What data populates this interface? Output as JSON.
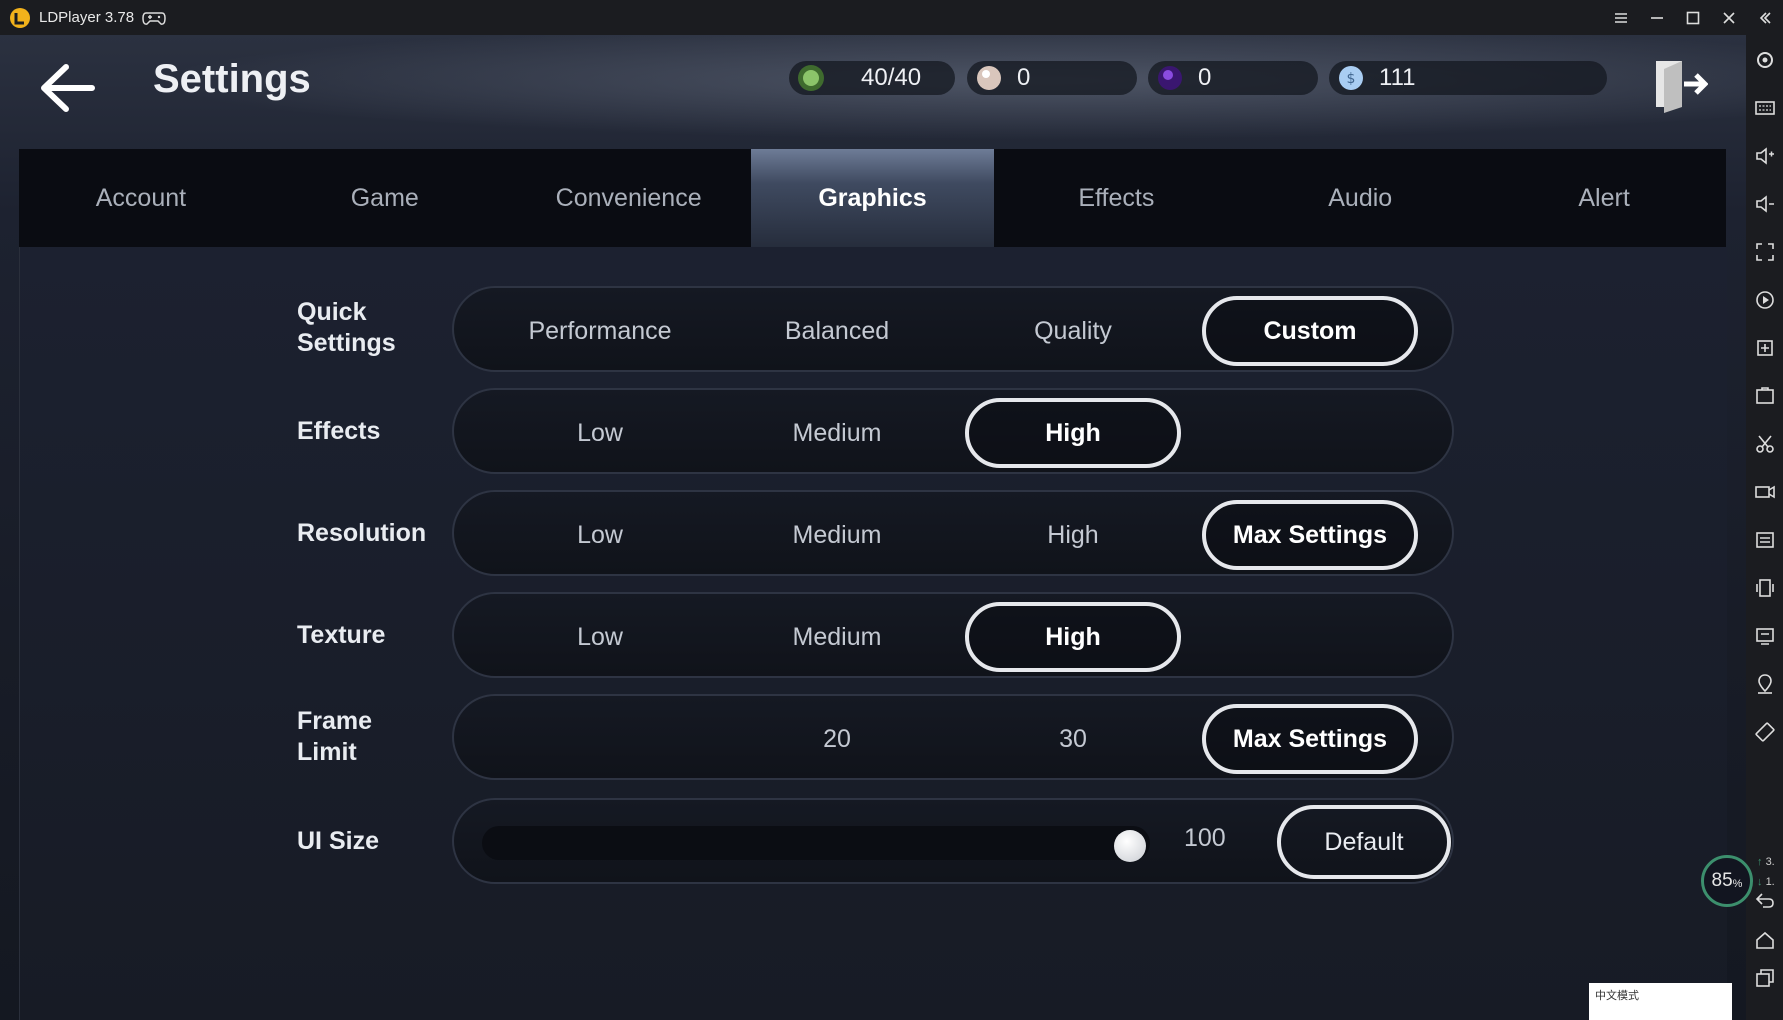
{
  "window": {
    "title": "LDPlayer 3.78",
    "controls": [
      "menu-icon",
      "minimize-icon",
      "maximize-icon",
      "close-icon",
      "collapse-sidebar-icon"
    ]
  },
  "header": {
    "title": "Settings",
    "currencies": [
      {
        "icon": "stamina-icon",
        "value": "40/40",
        "color": "#5f9c4a"
      },
      {
        "icon": "pearl-icon",
        "value": "0",
        "color": "#c9b4a8"
      },
      {
        "icon": "purple-gem-icon",
        "value": "0",
        "color": "#6a2fb5"
      },
      {
        "icon": "silver-coin-icon",
        "value": "111",
        "color": "#8fb8e8"
      }
    ]
  },
  "tabs": [
    {
      "label": "Account",
      "active": false
    },
    {
      "label": "Game",
      "active": false
    },
    {
      "label": "Convenience",
      "active": false
    },
    {
      "label": "Graphics",
      "active": true
    },
    {
      "label": "Effects",
      "active": false
    },
    {
      "label": "Audio",
      "active": false
    },
    {
      "label": "Alert",
      "active": false
    }
  ],
  "graphics": {
    "quick_settings": {
      "label_line1": "Quick",
      "label_line2": "Settings",
      "options": [
        "Performance",
        "Balanced",
        "Quality",
        "Custom"
      ],
      "selected": "Custom"
    },
    "effects": {
      "label": "Effects",
      "options": [
        "Low",
        "Medium",
        "High"
      ],
      "selected": "High"
    },
    "resolution": {
      "label": "Resolution",
      "options": [
        "Low",
        "Medium",
        "High",
        "Max Settings"
      ],
      "selected": "Max Settings"
    },
    "texture": {
      "label": "Texture",
      "options": [
        "Low",
        "Medium",
        "High"
      ],
      "selected": "High"
    },
    "frame_limit": {
      "label_line1": "Frame",
      "label_line2": "Limit",
      "options": [
        "20",
        "30",
        "Max Settings"
      ],
      "selected": "Max Settings"
    },
    "ui_size": {
      "label": "UI Size",
      "value": "100",
      "default_label": "Default"
    }
  },
  "emulator": {
    "perf_percent": "85",
    "perf_unit": "%",
    "net_up": "3.",
    "net_down": "1.",
    "ime_text": "中文模式",
    "accent": "#3c8f6d"
  }
}
